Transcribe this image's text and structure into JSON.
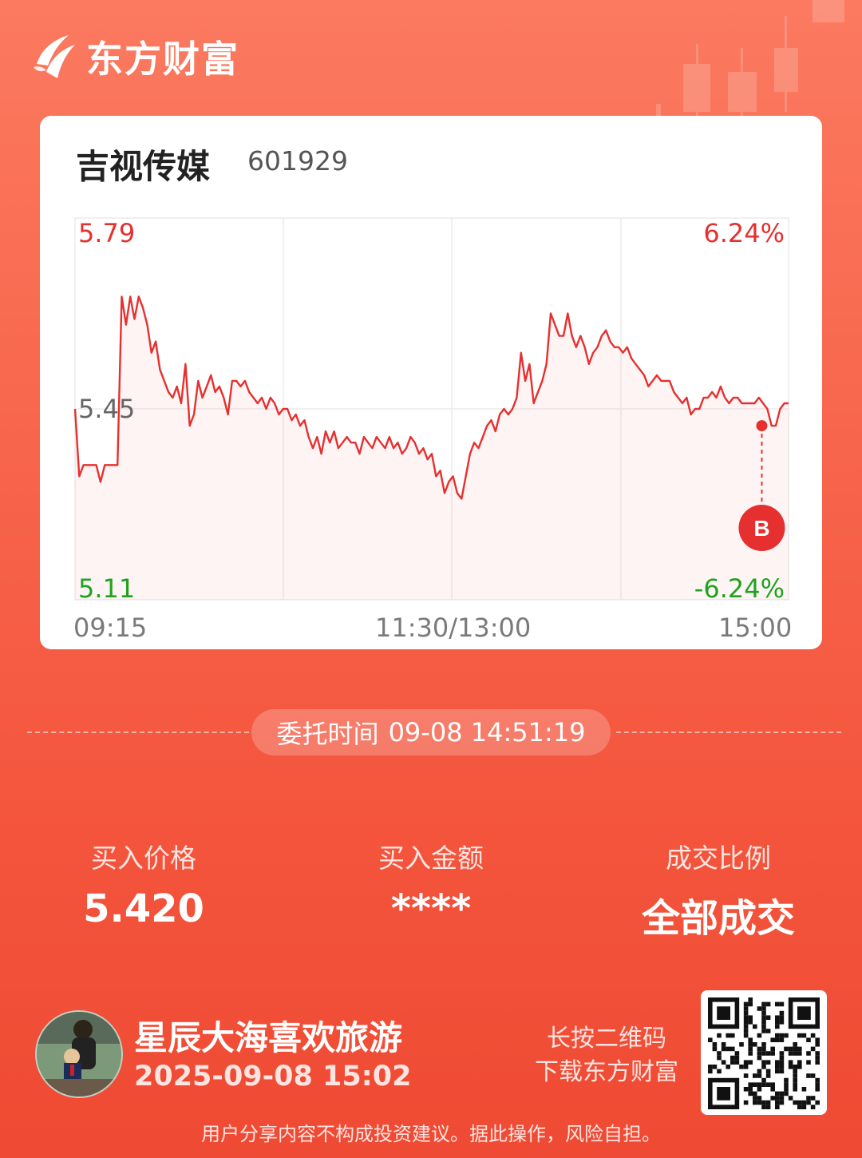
{
  "brand": {
    "name": "东方财富"
  },
  "stock": {
    "name": "吉视传媒",
    "code": "601929"
  },
  "chart_data": {
    "type": "line",
    "price_ticks": {
      "high": "5.79",
      "mid": "5.45",
      "low": "5.11"
    },
    "pct_ticks": {
      "high": "6.24%",
      "low": "-6.24%"
    },
    "x_ticks": [
      "09:15",
      "11:30/13:00",
      "15:00"
    ],
    "ylim": [
      5.11,
      5.79
    ],
    "series": [
      {
        "values": [
          5.45,
          5.33,
          5.35,
          5.35,
          5.35,
          5.35,
          5.32,
          5.35,
          5.35,
          5.35,
          5.35,
          5.65,
          5.6,
          5.65,
          5.61,
          5.65,
          5.63,
          5.6,
          5.55,
          5.57,
          5.52,
          5.5,
          5.48,
          5.47,
          5.49,
          5.46,
          5.53,
          5.42,
          5.44,
          5.5,
          5.47,
          5.49,
          5.51,
          5.48,
          5.49,
          5.47,
          5.44,
          5.5,
          5.5,
          5.49,
          5.5,
          5.48,
          5.47,
          5.46,
          5.47,
          5.45,
          5.47,
          5.46,
          5.44,
          5.45,
          5.45,
          5.43,
          5.44,
          5.42,
          5.43,
          5.4,
          5.38,
          5.4,
          5.37,
          5.41,
          5.39,
          5.41,
          5.38,
          5.39,
          5.4,
          5.39,
          5.39,
          5.37,
          5.4,
          5.39,
          5.38,
          5.4,
          5.39,
          5.38,
          5.4,
          5.38,
          5.39,
          5.37,
          5.38,
          5.4,
          5.39,
          5.37,
          5.38,
          5.36,
          5.37,
          5.33,
          5.34,
          5.3,
          5.32,
          5.33,
          5.3,
          5.29,
          5.33,
          5.37,
          5.39,
          5.38,
          5.4,
          5.42,
          5.43,
          5.41,
          5.44,
          5.45,
          5.44,
          5.45,
          5.47,
          5.55,
          5.5,
          5.53,
          5.46,
          5.48,
          5.5,
          5.53,
          5.62,
          5.6,
          5.58,
          5.58,
          5.62,
          5.58,
          5.56,
          5.58,
          5.56,
          5.53,
          5.55,
          5.56,
          5.58,
          5.59,
          5.57,
          5.56,
          5.56,
          5.55,
          5.56,
          5.54,
          5.53,
          5.52,
          5.51,
          5.49,
          5.5,
          5.51,
          5.5,
          5.5,
          5.5,
          5.48,
          5.47,
          5.46,
          5.47,
          5.44,
          5.45,
          5.45,
          5.47,
          5.47,
          5.48,
          5.47,
          5.49,
          5.47,
          5.46,
          5.47,
          5.47,
          5.46,
          5.46,
          5.46,
          5.46,
          5.47,
          5.46,
          5.45,
          5.42,
          5.42,
          5.45,
          5.46,
          5.46
        ],
        "x_range": [
          0,
          240
        ]
      }
    ],
    "trade_marker": {
      "label": "B",
      "price": 5.42,
      "time": "14:51"
    }
  },
  "order": {
    "time_label": "委托时间",
    "time_value": "09-08 14:51:19"
  },
  "stats": {
    "price_label": "买入价格",
    "price_value": "5.420",
    "amount_label": "买入金额",
    "amount_value": "****",
    "ratio_label": "成交比例",
    "ratio_value": "全部成交"
  },
  "user": {
    "name": "星辰大海喜欢旅游",
    "time": "2025-09-08 15:02"
  },
  "qr": {
    "hint_line1": "长按二维码",
    "hint_line2": "下载东方财富"
  },
  "disclaimer": "用户分享内容不构成投资建议。据此操作，风险自担。",
  "colors": {
    "up": "#e5302f",
    "down": "#1fa31f",
    "neutral": "#666666"
  }
}
